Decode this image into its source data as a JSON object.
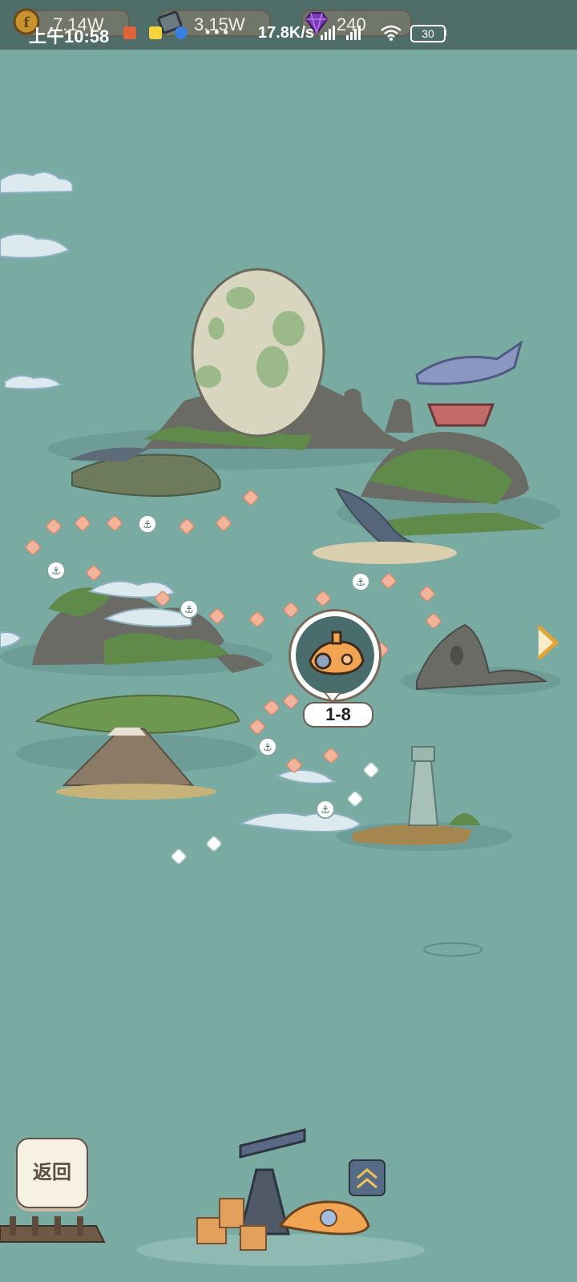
{
  "status_bar": {
    "time": "上午10:58",
    "network_speed": "17.8K/s",
    "battery": "30"
  },
  "resources": [
    {
      "name": "coin",
      "value": "7.14W"
    },
    {
      "name": "film",
      "value": "3.15W"
    },
    {
      "name": "gem",
      "value": "240"
    }
  ],
  "map": {
    "current_level": "1-8"
  },
  "buttons": {
    "back_label": "返回"
  },
  "colors": {
    "ocean": "#79aba2",
    "path_dot_completed": "#f2b49a",
    "path_dot_locked": "#ffffff",
    "gem": "#7b3bb8"
  }
}
